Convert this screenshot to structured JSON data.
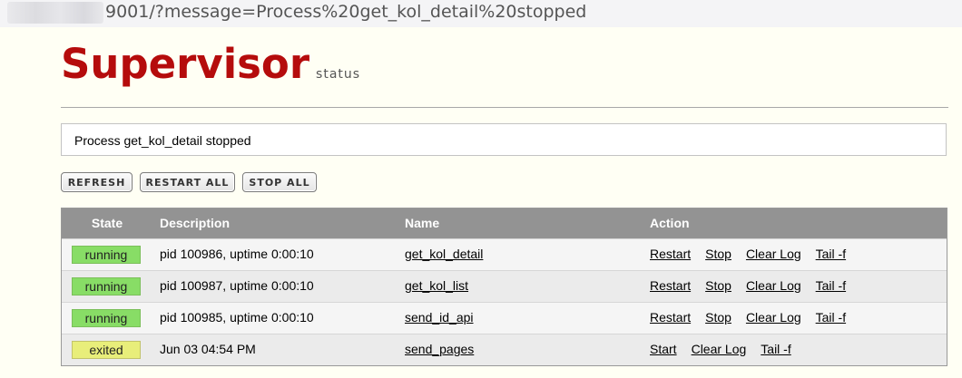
{
  "browser": {
    "url": "9001/?message=Process%20get_kol_detail%20stopped"
  },
  "header": {
    "logo": "Supervisor",
    "logo_sub": "status"
  },
  "message": "Process get_kol_detail stopped",
  "buttons": {
    "refresh": "REFRESH",
    "restart_all": "RESTART ALL",
    "stop_all": "STOP ALL"
  },
  "table": {
    "columns": [
      "State",
      "Description",
      "Name",
      "Action"
    ],
    "rows": [
      {
        "state": "running",
        "description": "pid 100986, uptime 0:00:10",
        "name": "get_kol_detail",
        "actions": [
          "Restart",
          "Stop",
          "Clear Log",
          "Tail -f"
        ]
      },
      {
        "state": "running",
        "description": "pid 100987, uptime 0:00:10",
        "name": "get_kol_list",
        "actions": [
          "Restart",
          "Stop",
          "Clear Log",
          "Tail -f"
        ]
      },
      {
        "state": "running",
        "description": "pid 100985, uptime 0:00:10",
        "name": "send_id_api",
        "actions": [
          "Restart",
          "Stop",
          "Clear Log",
          "Tail -f"
        ]
      },
      {
        "state": "exited",
        "description": "Jun 03 04:54 PM",
        "name": "send_pages",
        "actions": [
          "Start",
          "Clear Log",
          "Tail -f"
        ]
      }
    ]
  },
  "colors": {
    "logo": "#b50c0c",
    "running": "#88dd66",
    "exited": "#e8ee7a",
    "header_bg": "#939393",
    "page_bg": "#fffff4"
  }
}
